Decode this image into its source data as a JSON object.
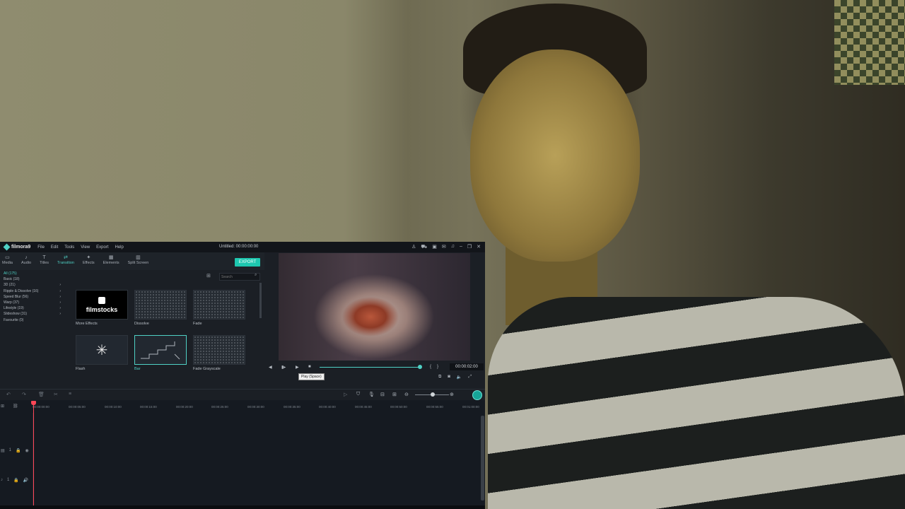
{
  "window": {
    "app_name": "filmora9",
    "title": "Untitled: 00:00:00:00"
  },
  "menu": [
    "File",
    "Edit",
    "Tools",
    "View",
    "Export",
    "Help"
  ],
  "tabs": [
    {
      "label": "Media",
      "icon": "folder-icon"
    },
    {
      "label": "Audio",
      "icon": "music-icon"
    },
    {
      "label": "Titles",
      "icon": "text-icon"
    },
    {
      "label": "Transition",
      "icon": "transition-icon",
      "active": true
    },
    {
      "label": "Effects",
      "icon": "effects-icon"
    },
    {
      "label": "Elements",
      "icon": "elements-icon"
    },
    {
      "label": "Split Screen",
      "icon": "split-screen-icon"
    }
  ],
  "export_label": "EXPORT",
  "categories": [
    "All (175)",
    "Basic (18)",
    "3D (21)",
    "Ripple & Dissolve (16)",
    "Speed Blur (56)",
    "Warp (37)",
    "Lifestyle (19)",
    "Slideshow (31)",
    "Favourite (0)"
  ],
  "search_placeholder": "Search",
  "transitions": [
    {
      "label": "More Effects",
      "brand": "filmstocks"
    },
    {
      "label": "Dissolve"
    },
    {
      "label": "Fade"
    },
    {
      "label": "Flash"
    },
    {
      "label": "Bar",
      "selected": true
    },
    {
      "label": "Fade Grayscale"
    }
  ],
  "player": {
    "timecode": "00:00:02:00",
    "tooltip": "Play (Space)"
  },
  "ruler_ticks": [
    "00:00:00:00",
    "00:00:05:00",
    "00:00:10:00",
    "00:00:15:00",
    "00:00:20:00",
    "00:00:25:00",
    "00:00:30:00",
    "00:00:35:00",
    "00:00:40:00",
    "00:00:45:00",
    "00:00:50:00",
    "00:00:55:00",
    "00:01:00:00"
  ],
  "tracks": [
    {
      "id": "1",
      "type": "video"
    },
    {
      "id": "1",
      "type": "audio"
    }
  ],
  "colors": {
    "accent": "#4fd1c5",
    "playhead": "#ff4757",
    "export": "#1ec8b0"
  }
}
